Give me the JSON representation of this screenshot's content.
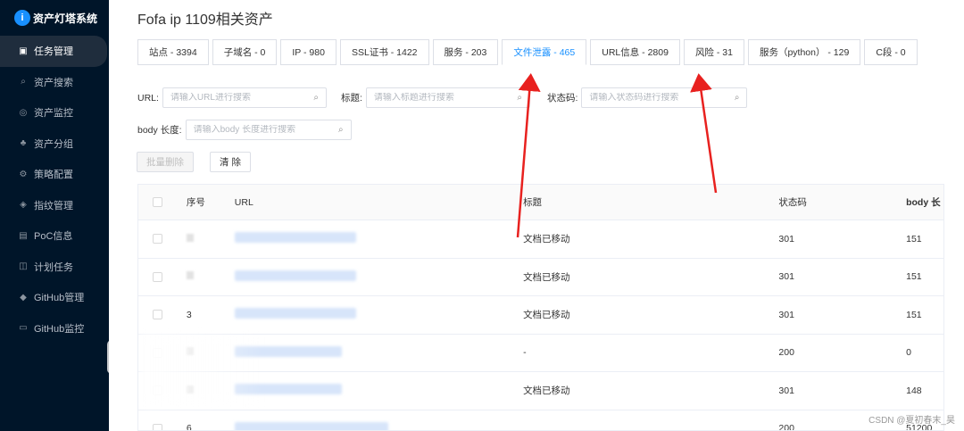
{
  "sidebar": {
    "brand": "资产灯塔系统",
    "items": [
      {
        "label": "任务管理",
        "icon": "▣"
      },
      {
        "label": "资产搜索",
        "icon": "⌕"
      },
      {
        "label": "资产监控",
        "icon": "◎"
      },
      {
        "label": "资产分组",
        "icon": "♣"
      },
      {
        "label": "策略配置",
        "icon": "⚙"
      },
      {
        "label": "指纹管理",
        "icon": "◈"
      },
      {
        "label": "PoC信息",
        "icon": "▤"
      },
      {
        "label": "计划任务",
        "icon": "◫"
      },
      {
        "label": "GitHub管理",
        "icon": "◆"
      },
      {
        "label": "GitHub监控",
        "icon": "▭"
      }
    ]
  },
  "page": {
    "title": "Fofa ip 1109相关资产"
  },
  "tabs": [
    {
      "label": "站点 - 3394"
    },
    {
      "label": "子域名 - 0"
    },
    {
      "label": "IP - 980"
    },
    {
      "label": "SSL证书 - 1422"
    },
    {
      "label": "服务 - 203"
    },
    {
      "label": "文件泄露 - 465"
    },
    {
      "label": "URL信息 - 2809"
    },
    {
      "label": "风险 - 31"
    },
    {
      "label": "服务（python） - 129"
    },
    {
      "label": "C段 - 0"
    }
  ],
  "filters": {
    "url": {
      "label": "URL:",
      "placeholder": "请输入URL进行搜索",
      "value": ""
    },
    "title": {
      "label": "标题:",
      "placeholder": "请输入标题进行搜索",
      "value": ""
    },
    "status": {
      "label": "状态码:",
      "placeholder": "请输入状态码进行搜索",
      "value": ""
    },
    "body": {
      "label": "body 长度:",
      "placeholder": "请输入body 长度进行搜索",
      "value": ""
    }
  },
  "buttons": {
    "batch_delete": "批量删除",
    "clear": "清 除"
  },
  "table": {
    "headers": {
      "index": "序号",
      "url": "URL",
      "title": "标题",
      "status": "状态码",
      "body": "body 长"
    },
    "rows": [
      {
        "index": "",
        "title": "文档已移动",
        "status": "301",
        "body": "151"
      },
      {
        "index": "",
        "title": "文档已移动",
        "status": "301",
        "body": "151"
      },
      {
        "index": "3",
        "title": "文档已移动",
        "status": "301",
        "body": "151"
      },
      {
        "index": "",
        "title": "-",
        "status": "200",
        "body": "0"
      },
      {
        "index": "",
        "title": "文档已移动",
        "status": "301",
        "body": "148"
      },
      {
        "index": "6",
        "title": "",
        "status": "200",
        "body": "51200"
      }
    ]
  },
  "watermark": "CSDN @夏初春末_昊",
  "colors": {
    "sidebar_bg": "#001529",
    "accent": "#1890ff",
    "arrow": "#e8211f"
  }
}
